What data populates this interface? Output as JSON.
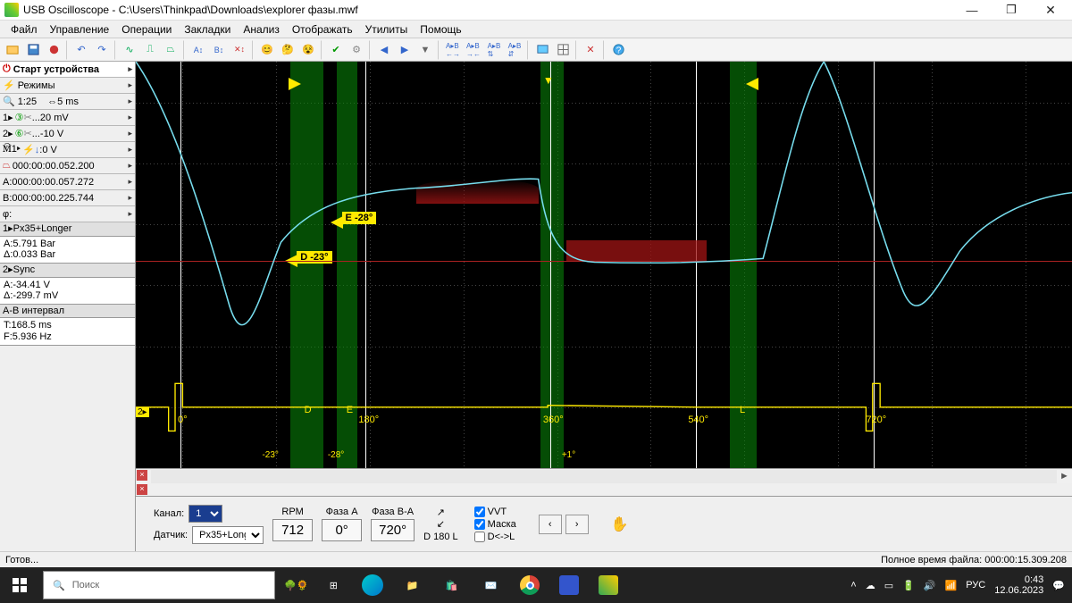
{
  "title": "USB Oscilloscope - C:\\Users\\Thinkpad\\Downloads\\explorer фазы.mwf",
  "menu": [
    "Файл",
    "Управление",
    "Операции",
    "Закладки",
    "Анализ",
    "Отображать",
    "Утилиты",
    "Помощь"
  ],
  "sidebar": {
    "start": "Старт устройства",
    "modes": "Режимы",
    "zoom": "1:25",
    "timediv": "5 ms",
    "ch1v": "20 mV",
    "ch2v": "-10 V",
    "trig": "0 V",
    "ts": "000:00:00.052.200",
    "curA": "A:000:00:00.057.272",
    "curB": "B:000:00:00.225.744",
    "phi": "φ:",
    "hdr1": "1▸Px35+Longer",
    "m1a": "A:5.791 Bar",
    "m1d": "Δ:0.033 Bar",
    "hdr2": "2▸Sync",
    "m2a": "A:-34.41 V",
    "m2d": "Δ:-299.7 mV",
    "hdr3": "A-B интервал",
    "m3t": "T:168.5 ms",
    "m3f": "F:5.936 Hz"
  },
  "scope": {
    "e_label": "E -28°",
    "d_label": "D -23°",
    "ch2_marker": "2▸",
    "deg0": "0°",
    "deg180": "180°",
    "deg360": "360°",
    "deg540": "540°",
    "deg720": "720°",
    "ltrD": "D",
    "ltrE": "E",
    "ltrL": "L",
    "ann_neg23": "-23°",
    "ann_neg28": "-28°",
    "ann_plus1": "+1°"
  },
  "bottom": {
    "channel_lbl": "Канал:",
    "channel_val": "1",
    "sensor_lbl": "Датчик:",
    "sensor_val": "Px35+Long",
    "rpm_lbl": "RPM",
    "rpm_val": "712",
    "phaseA_lbl": "Фаза А",
    "phaseA_val": "0°",
    "phaseBA_lbl": "Фаза B-A",
    "phaseBA_val": "720°",
    "d180l": "D 180 L",
    "vvt": "VVT",
    "mask": "Маска",
    "dtol": "D<->L"
  },
  "status": {
    "ready": "Готов...",
    "filetime": "Полное время файла: 000:00:15.309.208"
  },
  "taskbar": {
    "search_placeholder": "Поиск",
    "lang": "РУС",
    "time": "0:43",
    "date": "12.06.2023"
  }
}
